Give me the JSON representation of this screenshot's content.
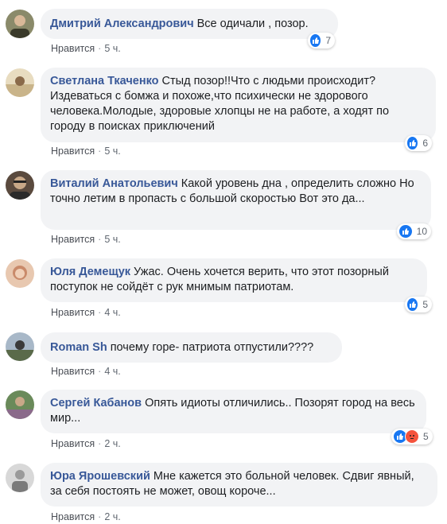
{
  "like_label": "Нравится",
  "comments": [
    {
      "author": "Дмитрий Александрович",
      "text": "Все одичали , позор.",
      "time": "5 ч.",
      "reactions": "7",
      "avatar_color": "#8a8a6a"
    },
    {
      "author": "Светлана Ткаченко",
      "text": "Стыд позор!!Что с людьми происходит? Издеваться с бомжа и похоже,что психически не здорового человека.Молодые, здоровые хлопцы не на работе, а ходят по городу в поисках приключений",
      "time": "5 ч.",
      "reactions": "6",
      "avatar_color": "#c9b48a"
    },
    {
      "author": "Виталий Анатольевич",
      "text": "Какой уровень дна , определить сложно Но точно летим в пропасть с большой скоростью Вот это да...",
      "time": "5 ч.",
      "reactions": "10",
      "avatar_color": "#5a4a3e"
    },
    {
      "author": "Юля Демещук",
      "text": "Ужас. Очень хочется верить, что этот позорный поступок не сойдёт с рук мнимым патриотам.",
      "time": "4 ч.",
      "reactions": "5",
      "avatar_color": "#c98a6a"
    },
    {
      "author": "Roman Sh",
      "text": "почему горе- патриота отпустили????",
      "time": "4 ч.",
      "reactions": "",
      "avatar_color": "#7a8a9a"
    },
    {
      "author": "Сергей Кабанов",
      "text": "Опять идиоты отличились.. Позорят город на весь мир...",
      "time": "2 ч.",
      "reactions": "5",
      "avatar_color": "#6a8a5a"
    },
    {
      "author": "Юра Ярошевский",
      "text": "Мне кажется это больной человек. Сдвиг явный, за себя постоять не может, овощ короче...",
      "time": "2 ч.",
      "reactions": "",
      "avatar_color": "#9a9a9a"
    }
  ]
}
